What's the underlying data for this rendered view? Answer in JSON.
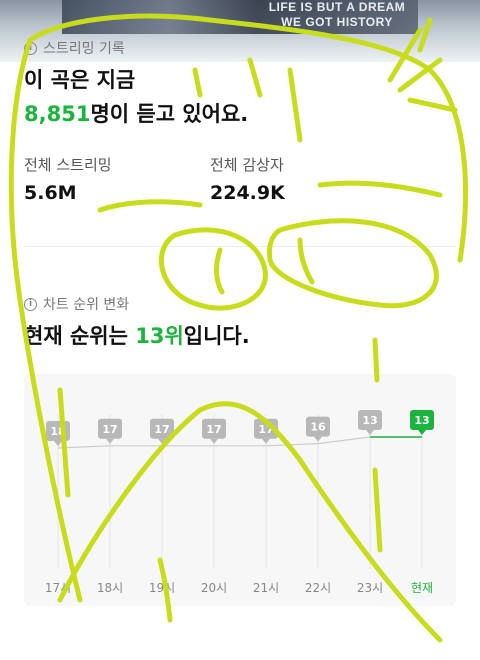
{
  "banner": {
    "line1": "LIFE IS BUT A DREAM",
    "line2": "WE GOT HISTORY"
  },
  "streaming": {
    "section_title": "스트리밍 기록",
    "headline_prefix": "이 곡은 지금",
    "listeners_count": "8,851",
    "listeners_suffix": "명이 듣고 있어요.",
    "total_streams_label": "전체 스트리밍",
    "total_streams_value": "5.6M",
    "total_listeners_label": "전체 감상자",
    "total_listeners_value": "224.9K"
  },
  "ranking": {
    "section_title": "차트 순위 변화",
    "headline_prefix": "현재 순위는",
    "current_rank": "13위",
    "headline_suffix": "입니다."
  },
  "chart_data": {
    "type": "line",
    "categories": [
      "17시",
      "18시",
      "19시",
      "20시",
      "21시",
      "22시",
      "23시",
      "현재"
    ],
    "values": [
      18,
      17,
      17,
      17,
      17,
      16,
      13,
      13
    ],
    "ylim": [
      1,
      100
    ],
    "colors": {
      "line": "#cccccc",
      "current": "#1db33f",
      "badge": "#b8b8b8"
    },
    "highlight_last": true
  },
  "colors": {
    "accent": "#1db33f",
    "scribble": "#c8dc1e"
  }
}
